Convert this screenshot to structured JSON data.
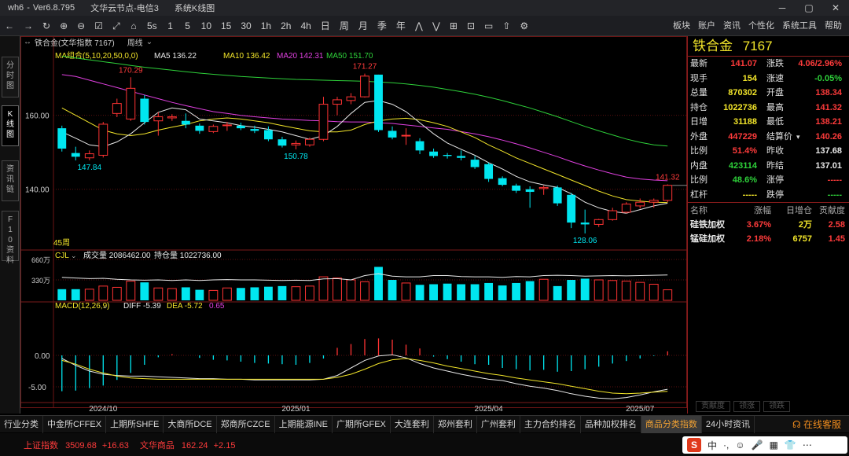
{
  "window": {
    "app": "wh6",
    "version": "Ver6.8.795",
    "server": "文华云节点-电信3",
    "module": "系统K线图",
    "controls": [
      "─",
      "▢",
      "✕"
    ]
  },
  "toolbar": {
    "buttons": [
      "←",
      "→",
      "↻",
      "⊕",
      "⊖",
      "☑",
      "⤢",
      "⌂",
      "5s",
      "1",
      "5",
      "10",
      "15",
      "30",
      "1h",
      "2h",
      "4h",
      "日",
      "周",
      "月",
      "季",
      "年",
      "⋀",
      "⋁",
      "⊞",
      "⊡",
      "▭",
      "⇧",
      "⚙"
    ],
    "right": [
      "板块",
      "账户",
      "资讯",
      "个性化",
      "系统工具",
      "帮助"
    ]
  },
  "left_tabs": [
    {
      "label": "分时图"
    },
    {
      "label": "K线图"
    },
    {
      "label": "资讯链"
    },
    {
      "label": "F10资料"
    }
  ],
  "chart_header": {
    "contract": "铁合金(文华指数 7167)",
    "period": "周线"
  },
  "ma_legend": {
    "group": "MA组合(5,10,20,50,0,0)",
    "ma5": "MA5 136.22",
    "ma10": "MA10 136.42",
    "ma20": "MA20 142.31",
    "ma50": "MA50 151.70"
  },
  "vol_legend": {
    "name": "CJL",
    "vol": "成交量 2086462.00",
    "oi": "持仓量 1022736.00"
  },
  "macd_legend": {
    "name": "MACD(12,26,9)",
    "diff": "DIFF -5.39",
    "dea": "DEA -5.72",
    "macd": "0.65"
  },
  "axis_labels": {
    "price": [
      "160.00",
      "140.00"
    ],
    "volume": [
      "660万",
      "330万"
    ],
    "macd": [
      "0.00",
      "-5.00"
    ],
    "dates": [
      "2024/10",
      "2025/01",
      "2025/04",
      "2025/07"
    ],
    "week_count": "45周"
  },
  "annotations": {
    "high1": "170.29",
    "high2": "171.27",
    "low1": "147.84",
    "low2": "150.78",
    "low3": "128.06",
    "last_high": "141.32"
  },
  "colors": {
    "up": "#ff3333",
    "down": "#00e6f0",
    "ma5": "#e8e8e8",
    "ma10": "#f2e52a",
    "ma20": "#e040e0",
    "ma50": "#2ed13a",
    "panel_border": "#8a1c1c"
  },
  "quote": {
    "name": "铁合金",
    "code": "7167",
    "rows": [
      {
        "l1": "最新",
        "v1": "141.07",
        "c1": "red",
        "l2": "涨跌",
        "v2": "4.06/2.96%",
        "c2": "red"
      },
      {
        "l1": "现手",
        "v1": "154",
        "c1": "yellow",
        "l2": "涨速",
        "v2": "-0.05%",
        "c2": "green"
      },
      {
        "l1": "总量",
        "v1": "870302",
        "c1": "yellow",
        "l2": "开盘",
        "v2": "138.34",
        "c2": "red"
      },
      {
        "l1": "持仓",
        "v1": "1022736",
        "c1": "yellow",
        "l2": "最高",
        "v2": "141.32",
        "c2": "red"
      },
      {
        "l1": "日增",
        "v1": "31188",
        "c1": "yellow",
        "l2": "最低",
        "v2": "138.21",
        "c2": "red"
      },
      {
        "l1": "外盘",
        "v1": "447229",
        "c1": "red",
        "l2": "结算价",
        "v2": "140.26",
        "c2": "red"
      },
      {
        "l1": "比例",
        "v1": "51.4%",
        "c1": "red",
        "l2": "昨收",
        "v2": "137.68",
        "c2": "white"
      },
      {
        "l1": "内盘",
        "v1": "423114",
        "c1": "green",
        "l2": "昨结",
        "v2": "137.01",
        "c2": "white"
      },
      {
        "l1": "比例",
        "v1": "48.6%",
        "c1": "green",
        "l2": "涨停",
        "v2": "-----",
        "c2": "red"
      },
      {
        "l1": "杠杆",
        "v1": "-----",
        "c1": "yellow",
        "l2": "跌停",
        "v2": "-----",
        "c2": "green"
      }
    ]
  },
  "members": {
    "headers": [
      "名称",
      "涨幅",
      "日增仓",
      "贡献度"
    ],
    "rows": [
      {
        "name": "硅铁加权",
        "chg": "3.67%",
        "oi": "2万",
        "contrib": "2.58"
      },
      {
        "name": "锰硅加权",
        "chg": "2.18%",
        "oi": "6757",
        "contrib": "1.45"
      }
    ]
  },
  "panel_tabs": [
    "贡献度",
    "领涨",
    "领跌"
  ],
  "bottom_tabs": [
    "行业分类",
    "中金所CFFEX",
    "上期所SHFE",
    "大商所DCE",
    "郑商所CZCE",
    "上期能源INE",
    "广期所GFEX",
    "大连套利",
    "郑州套利",
    "广州套利",
    "主力合约排名",
    "品种加权排名",
    "商品分类指数",
    "24小时资讯"
  ],
  "bottom_active": "商品分类指数",
  "support": "在线客服",
  "status": [
    {
      "label": "上证指数",
      "value": "3509.68",
      "chg": "+16.63"
    },
    {
      "label": "文华商品",
      "value": "162.24",
      "chg": "+2.15"
    }
  ],
  "ime": [
    "S",
    "中",
    "·,",
    "☺",
    "🎤",
    "▦",
    "👕",
    "⋯"
  ],
  "chart_data": {
    "type": "candlestick",
    "x_label_ticks": [
      "2024/10",
      "2025/01",
      "2025/04",
      "2025/07"
    ],
    "candles": [
      {
        "o": 156.5,
        "h": 157.2,
        "l": 150.2,
        "c": 151.0
      },
      {
        "o": 149.8,
        "h": 151.5,
        "l": 147.8,
        "c": 148.8
      },
      {
        "o": 148.5,
        "h": 150.5,
        "l": 147.84,
        "c": 149.6
      },
      {
        "o": 149.2,
        "h": 158.2,
        "l": 148.6,
        "c": 157.6
      },
      {
        "o": 160.5,
        "h": 164.5,
        "l": 159.5,
        "c": 163.2
      },
      {
        "o": 159.0,
        "h": 170.29,
        "l": 158.5,
        "c": 167.3
      },
      {
        "o": 164.5,
        "h": 165.5,
        "l": 157.5,
        "c": 158.2
      },
      {
        "o": 158.5,
        "h": 160.8,
        "l": 154.5,
        "c": 159.6
      },
      {
        "o": 159.3,
        "h": 160.3,
        "l": 158.5,
        "c": 159.6
      },
      {
        "o": 158.5,
        "h": 160.5,
        "l": 156.5,
        "c": 157.5
      },
      {
        "o": 157.2,
        "h": 157.8,
        "l": 155.0,
        "c": 155.8
      },
      {
        "o": 155.6,
        "h": 157.5,
        "l": 155.2,
        "c": 157.0
      },
      {
        "o": 157.2,
        "h": 158.2,
        "l": 155.8,
        "c": 157.4
      },
      {
        "o": 157.2,
        "h": 158.0,
        "l": 156.0,
        "c": 156.5
      },
      {
        "o": 156.3,
        "h": 157.2,
        "l": 155.2,
        "c": 155.8
      },
      {
        "o": 156.0,
        "h": 157.0,
        "l": 153.0,
        "c": 153.5
      },
      {
        "o": 153.5,
        "h": 154.2,
        "l": 151.3,
        "c": 151.8
      },
      {
        "o": 152.0,
        "h": 153.2,
        "l": 150.78,
        "c": 152.4
      },
      {
        "o": 152.0,
        "h": 154.0,
        "l": 151.5,
        "c": 153.5
      },
      {
        "o": 153.5,
        "h": 165.0,
        "l": 153.0,
        "c": 163.0
      },
      {
        "o": 163.0,
        "h": 165.0,
        "l": 160.0,
        "c": 164.2
      },
      {
        "o": 164.0,
        "h": 166.0,
        "l": 163.0,
        "c": 165.0
      },
      {
        "o": 165.0,
        "h": 171.27,
        "l": 164.8,
        "c": 170.6
      },
      {
        "o": 171.0,
        "h": 171.0,
        "l": 155.5,
        "c": 156.0
      },
      {
        "o": 155.8,
        "h": 157.0,
        "l": 153.5,
        "c": 154.0
      },
      {
        "o": 154.5,
        "h": 156.5,
        "l": 152.0,
        "c": 154.6
      },
      {
        "o": 153.0,
        "h": 153.8,
        "l": 149.5,
        "c": 150.5
      },
      {
        "o": 150.2,
        "h": 151.0,
        "l": 148.5,
        "c": 149.0
      },
      {
        "o": 149.3,
        "h": 149.8,
        "l": 148.3,
        "c": 149.0
      },
      {
        "o": 149.0,
        "h": 150.5,
        "l": 147.8,
        "c": 148.5
      },
      {
        "o": 148.0,
        "h": 149.0,
        "l": 145.5,
        "c": 146.0
      },
      {
        "o": 146.8,
        "h": 147.2,
        "l": 142.0,
        "c": 142.8
      },
      {
        "o": 143.0,
        "h": 143.5,
        "l": 140.8,
        "c": 141.2
      },
      {
        "o": 141.0,
        "h": 141.5,
        "l": 139.0,
        "c": 139.6
      },
      {
        "o": 140.0,
        "h": 140.8,
        "l": 135.0,
        "c": 139.3
      },
      {
        "o": 140.2,
        "h": 141.0,
        "l": 138.5,
        "c": 140.5
      },
      {
        "o": 140.5,
        "h": 141.0,
        "l": 135.5,
        "c": 136.2
      },
      {
        "o": 138.5,
        "h": 139.0,
        "l": 129.5,
        "c": 131.0
      },
      {
        "o": 131.0,
        "h": 134.5,
        "l": 128.06,
        "c": 130.5
      },
      {
        "o": 130.5,
        "h": 132.0,
        "l": 129.8,
        "c": 131.8
      },
      {
        "o": 131.8,
        "h": 135.0,
        "l": 131.5,
        "c": 134.2
      },
      {
        "o": 133.8,
        "h": 136.5,
        "l": 133.5,
        "c": 136.0
      },
      {
        "o": 135.5,
        "h": 137.5,
        "l": 134.8,
        "c": 136.5
      },
      {
        "o": 136.5,
        "h": 137.5,
        "l": 135.0,
        "c": 137.0
      },
      {
        "o": 137.0,
        "h": 141.32,
        "l": 136.5,
        "c": 141.07
      }
    ],
    "ma5": [
      155.5,
      153.8,
      152.0,
      151.5,
      152.8,
      155.0,
      158.0,
      160.8,
      162.0,
      161.5,
      159.0,
      158.5,
      158.0,
      157.2,
      156.8,
      156.2,
      155.5,
      154.5,
      153.5,
      154.5,
      157.0,
      160.5,
      163.5,
      164.0,
      163.0,
      161.0,
      158.0,
      155.0,
      152.5,
      150.8,
      149.2,
      147.2,
      145.5,
      143.5,
      142.0,
      141.2,
      140.5,
      138.8,
      136.5,
      135.0,
      134.0,
      133.5,
      134.5,
      135.5,
      136.22
    ],
    "ma10": [
      162.0,
      160.0,
      158.0,
      156.0,
      155.0,
      154.5,
      155.0,
      156.0,
      156.8,
      157.5,
      158.5,
      159.0,
      159.3,
      159.0,
      158.5,
      158.0,
      157.2,
      156.5,
      155.8,
      155.5,
      155.5,
      156.0,
      157.5,
      158.5,
      159.0,
      159.2,
      158.8,
      158.0,
      157.0,
      155.5,
      154.0,
      152.0,
      150.3,
      148.5,
      147.0,
      145.5,
      144.0,
      142.5,
      141.0,
      139.5,
      138.2,
      137.2,
      136.8,
      136.5,
      136.42
    ],
    "ma20": [
      171.0,
      170.5,
      169.5,
      168.5,
      167.5,
      166.5,
      165.5,
      164.5,
      163.5,
      162.6,
      161.8,
      161.0,
      160.5,
      160.0,
      159.6,
      159.3,
      159.0,
      158.8,
      158.6,
      158.5,
      158.3,
      158.2,
      158.2,
      158.0,
      157.8,
      157.4,
      157.0,
      156.6,
      156.2,
      155.6,
      155.0,
      154.2,
      153.3,
      152.3,
      151.2,
      150.0,
      148.8,
      147.5,
      146.3,
      145.2,
      144.2,
      143.3,
      142.8,
      142.5,
      142.31
    ],
    "ma50": [
      176.0,
      175.5,
      175.0,
      174.5,
      174.0,
      173.5,
      173.0,
      172.6,
      172.2,
      171.8,
      171.4,
      171.1,
      170.8,
      170.5,
      170.3,
      170.1,
      169.9,
      169.7,
      169.6,
      169.5,
      169.4,
      169.3,
      169.2,
      169.0,
      168.8,
      168.5,
      168.1,
      167.6,
      167.0,
      166.4,
      165.7,
      164.9,
      164.0,
      163.0,
      162.0,
      160.8,
      159.6,
      158.3,
      157.0,
      155.8,
      154.7,
      153.6,
      152.7,
      152.0,
      151.7
    ],
    "volume_wan": [
      180,
      180,
      180,
      230,
      210,
      310,
      290,
      200,
      190,
      210,
      170,
      160,
      200,
      200,
      210,
      220,
      230,
      220,
      230,
      380,
      360,
      330,
      300,
      540,
      330,
      280,
      250,
      260,
      270,
      260,
      260,
      280,
      240,
      280,
      310,
      340,
      230,
      330,
      350,
      330,
      320,
      310,
      290,
      260,
      170
    ],
    "oi_wan": [
      370,
      360,
      350,
      355,
      340,
      330,
      325,
      330,
      320,
      330,
      320,
      330,
      335,
      330,
      330,
      325,
      320,
      325,
      320,
      345,
      350,
      330,
      400,
      430,
      390,
      380,
      380,
      400,
      400,
      385,
      380,
      380,
      370,
      385,
      380,
      400,
      405,
      400,
      390,
      395,
      400,
      395,
      400,
      405,
      410
    ],
    "macd_hist": [
      -5.7,
      -5.6,
      -5.2,
      -4.8,
      -3.9,
      -2.8,
      -1.5,
      -0.3,
      0.2,
      0.0,
      -0.4,
      -0.7,
      -0.8,
      -1.0,
      -1.2,
      -1.3,
      -1.4,
      -1.5,
      -1.2,
      -0.5,
      1.2,
      1.8,
      2.6,
      2.7,
      2.5,
      1.7,
      1.1,
      -0.2,
      -0.6,
      -1.0,
      -1.4,
      -1.5,
      -2.0,
      -2.2,
      -2.4,
      -2.3,
      -2.6,
      -2.5,
      -2.2,
      -1.8,
      -1.3,
      -0.9,
      -0.5,
      -0.1,
      0.65
    ],
    "diff": [
      -0.5,
      -1.6,
      -2.5,
      -3.0,
      -3.2,
      -3.3,
      -3.3,
      -3.4,
      -3.5,
      -3.6,
      -3.7,
      -3.7,
      -3.8,
      -3.8,
      -3.9,
      -3.9,
      -3.9,
      -3.9,
      -3.9,
      -3.8,
      -3.2,
      -2.0,
      -0.8,
      -0.1,
      0.1,
      -0.4,
      -1.3,
      -2.0,
      -2.5,
      -3.0,
      -3.4,
      -3.8,
      -4.0,
      -4.5,
      -4.9,
      -5.2,
      -5.6,
      -6.1,
      -6.5,
      -6.8,
      -6.9,
      -6.7,
      -6.3,
      -5.8,
      -5.39
    ],
    "dea": [
      -0.8,
      -1.4,
      -2.2,
      -2.8,
      -3.3,
      -3.6,
      -3.7,
      -3.8,
      -3.8,
      -3.8,
      -3.8,
      -3.8,
      -3.8,
      -3.8,
      -3.8,
      -3.8,
      -3.8,
      -3.8,
      -3.8,
      -3.8,
      -3.5,
      -3.0,
      -2.2,
      -1.3,
      -0.7,
      -0.5,
      -0.8,
      -1.2,
      -1.7,
      -2.1,
      -2.5,
      -2.9,
      -3.2,
      -3.6,
      -3.9,
      -4.2,
      -4.5,
      -4.9,
      -5.3,
      -5.7,
      -6.0,
      -6.1,
      -6.0,
      -5.85,
      -5.72
    ],
    "price_range": [
      124,
      178
    ],
    "volume_range_wan": [
      0,
      660
    ],
    "macd_range": [
      -7,
      7
    ]
  }
}
